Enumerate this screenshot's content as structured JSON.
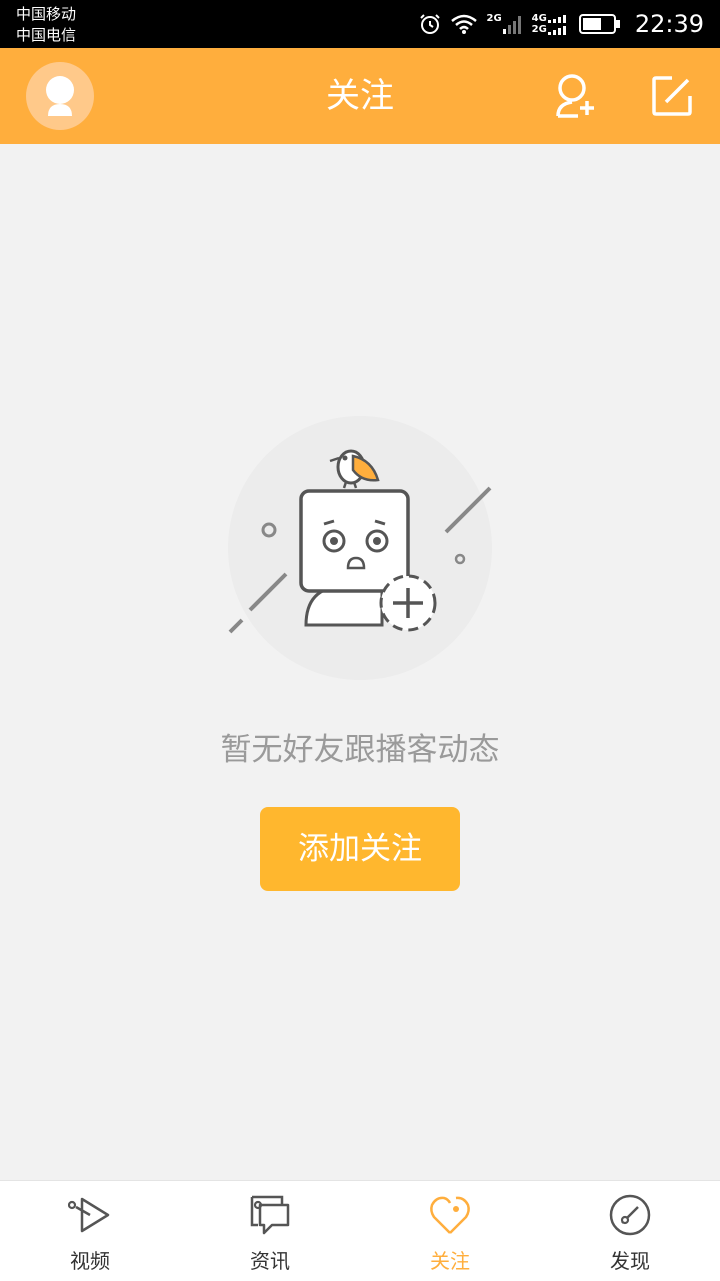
{
  "status_bar": {
    "carrier_1": "中国移动",
    "carrier_2": "中国电信",
    "net_1": "2G",
    "net_2a": "4G",
    "net_2b": "2G",
    "time": "22:39"
  },
  "header": {
    "title": "关注",
    "icons": [
      "avatar",
      "add-friend-icon",
      "edit-icon"
    ]
  },
  "empty_state": {
    "message": "暂无好友跟播客动态",
    "button_label": "添加关注"
  },
  "bottom_nav": {
    "items": [
      {
        "label": "视频",
        "icon": "video-play-icon"
      },
      {
        "label": "资讯",
        "icon": "news-icon"
      },
      {
        "label": "关注",
        "icon": "follow-heart-icon"
      },
      {
        "label": "发现",
        "icon": "discover-compass-icon"
      }
    ],
    "active_index": 2
  },
  "colors": {
    "accent": "#ffae3d",
    "button": "#ffb72e",
    "background": "#f2f2f2"
  }
}
